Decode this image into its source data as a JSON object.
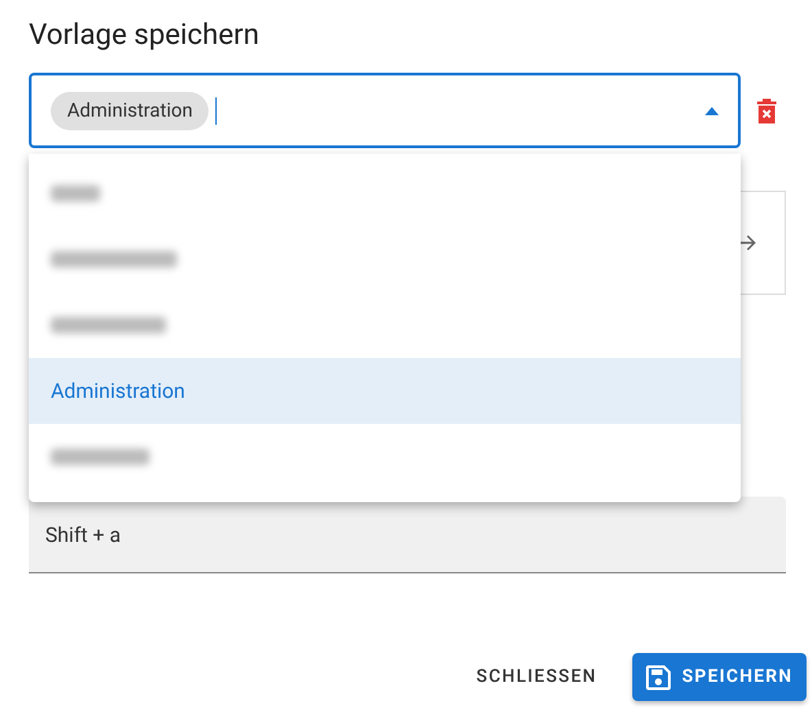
{
  "dialog": {
    "title": "Vorlage speichern"
  },
  "select_field": {
    "chips": [
      "Administration"
    ],
    "expanded": true
  },
  "menu": {
    "items": [
      {
        "kind": "redacted",
        "selected": false
      },
      {
        "kind": "redacted",
        "selected": false
      },
      {
        "kind": "redacted",
        "selected": false
      },
      {
        "kind": "option",
        "label": "Administration",
        "selected": true
      },
      {
        "kind": "redacted",
        "selected": false
      }
    ]
  },
  "shortcut_field": {
    "value": "Shift + a"
  },
  "buttons": [
    {
      "kind": "text",
      "label": "SCHLIESSEN"
    },
    {
      "kind": "primary",
      "label": "SPEICHERN"
    }
  ]
}
